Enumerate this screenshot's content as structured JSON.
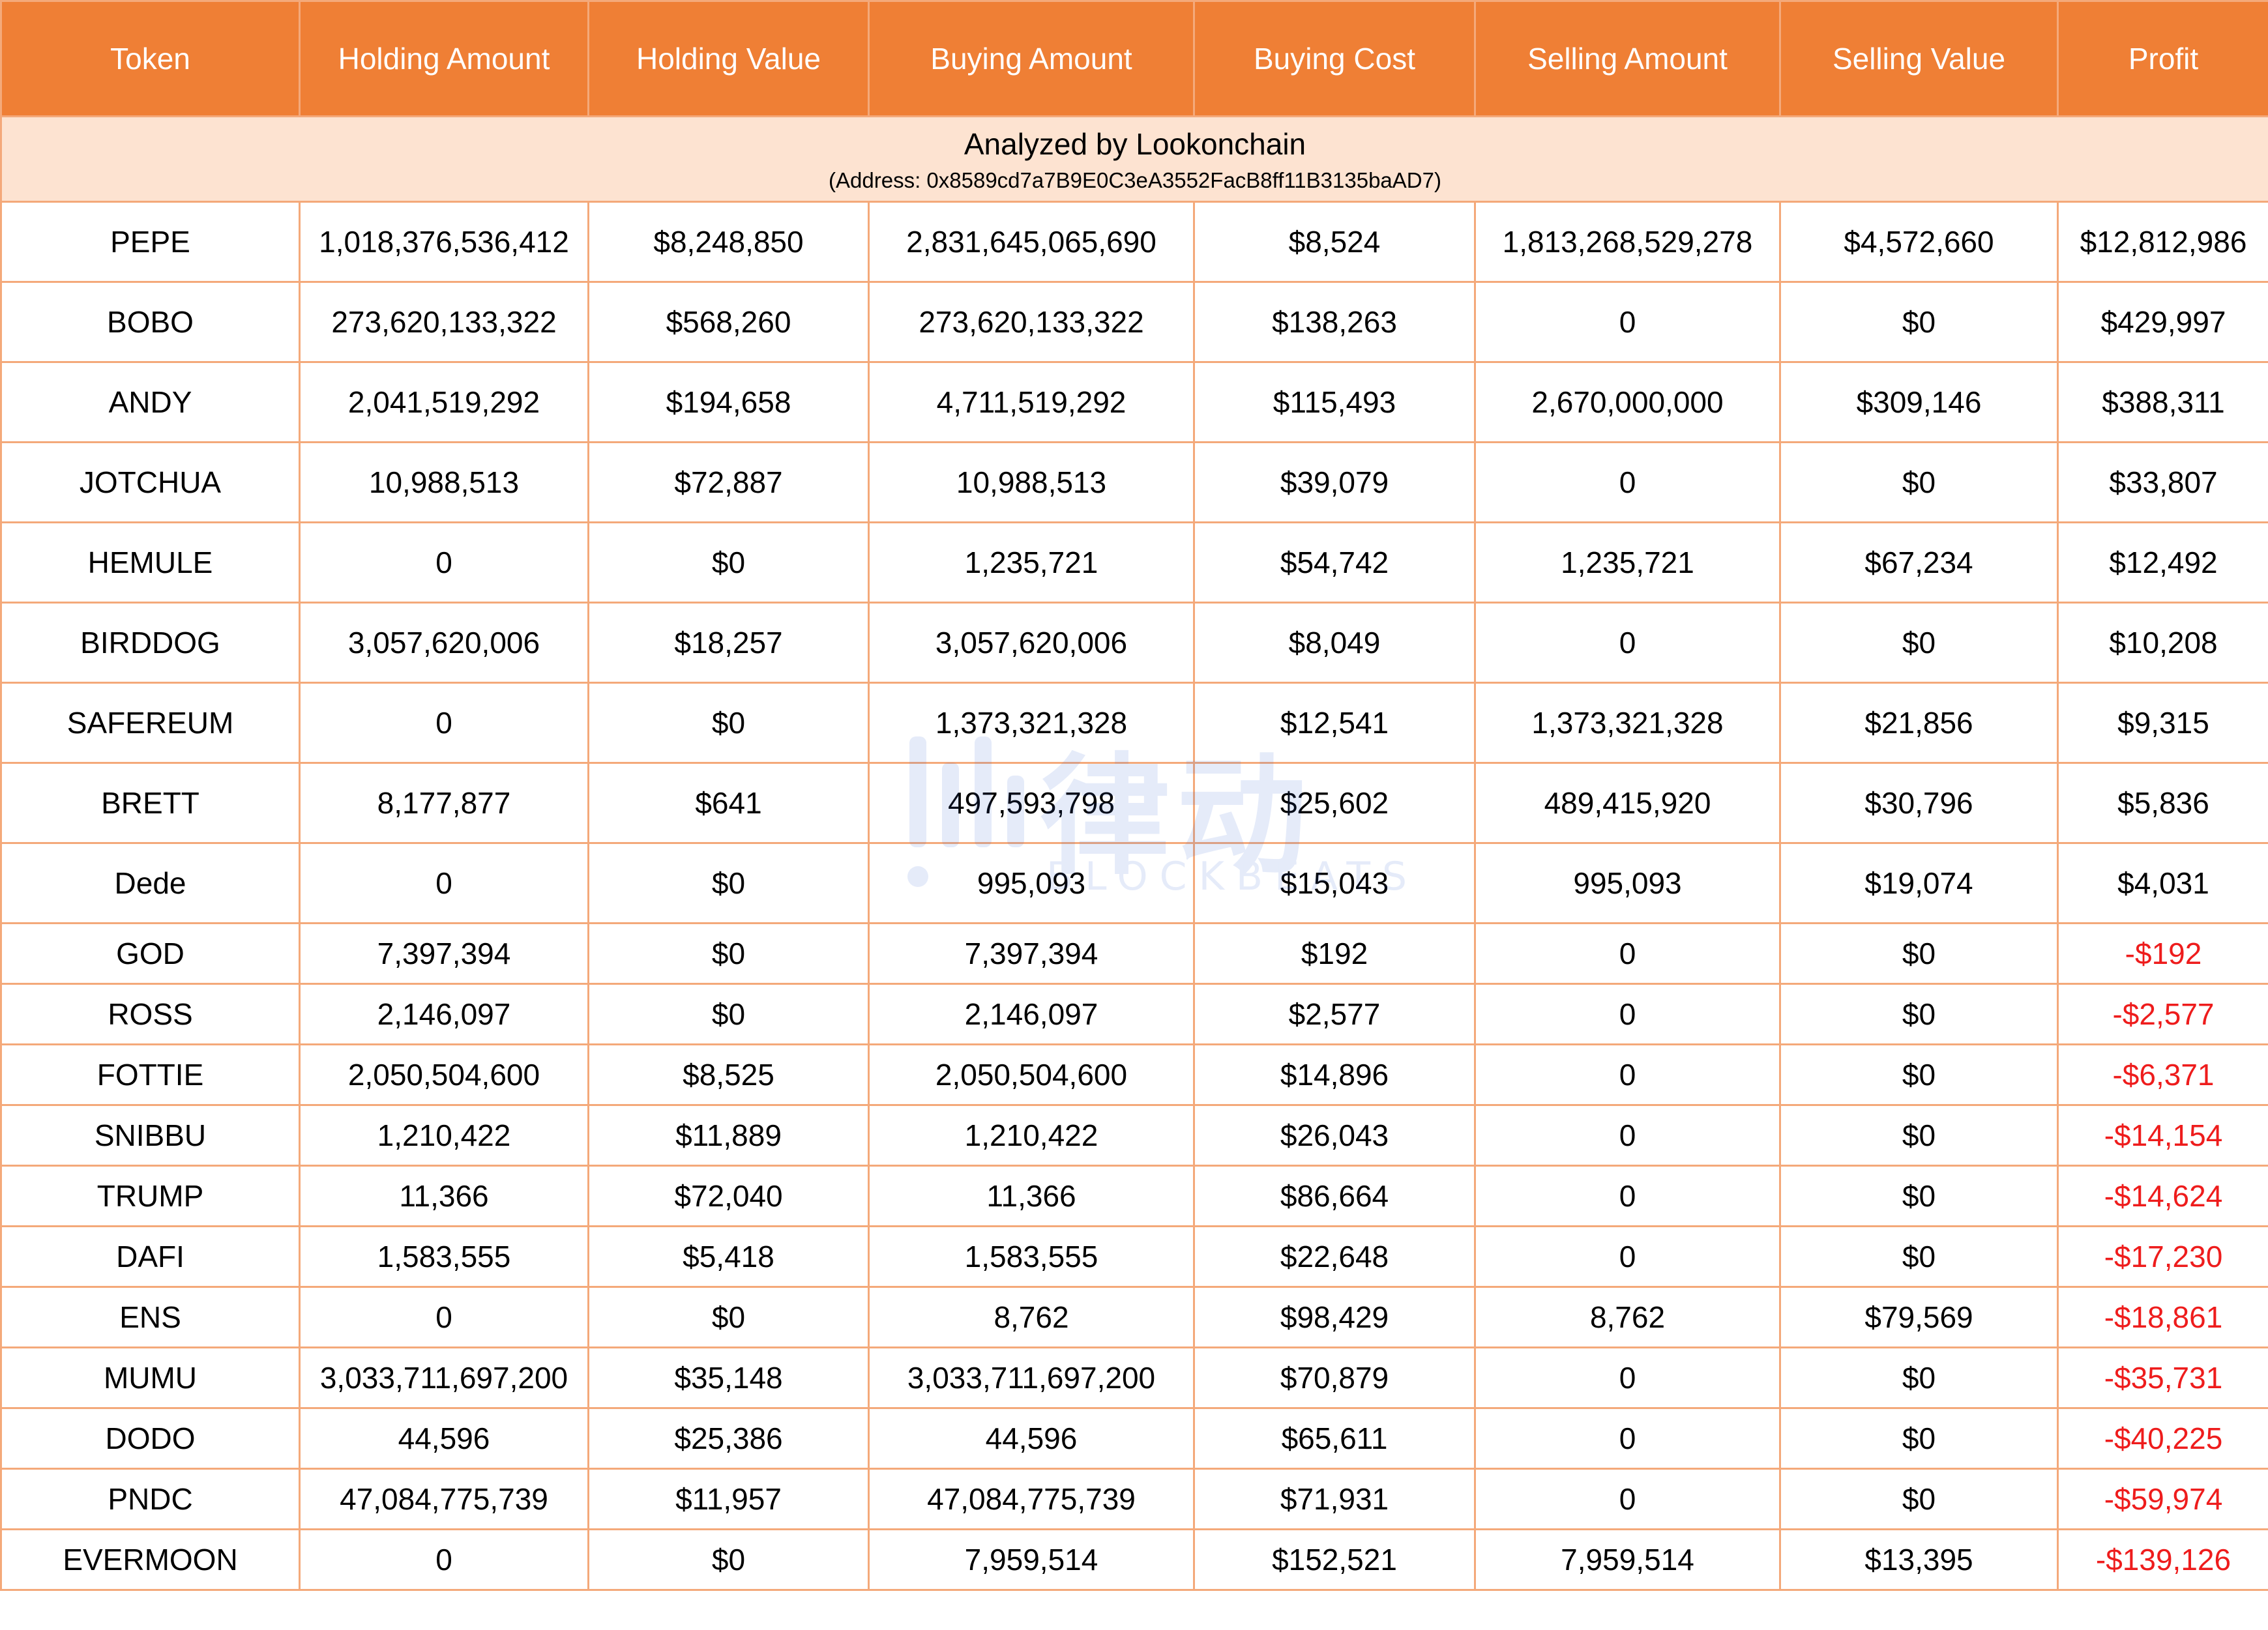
{
  "columns": [
    "Token",
    "Holding Amount",
    "Holding Value",
    "Buying Amount",
    "Buying Cost",
    "Selling Amount",
    "Selling Value",
    "Profit"
  ],
  "banner": {
    "title": "Analyzed by Lookonchain",
    "address": "(Address: 0x8589cd7a7B9E0C3eA3552FacB8ff11B3135baAD7)"
  },
  "watermark": {
    "cn": "律动",
    "en": "BLOCKBEATS",
    "color": "#2f62d6"
  },
  "colors": {
    "header_bg": "#ef7f35",
    "banner_bg": "#fde3d1",
    "border": "#f4a97a",
    "negative": "#ee1c1c"
  },
  "rows": [
    {
      "token": "PEPE",
      "holding_amount": "1,018,376,536,412",
      "holding_value": "$8,248,850",
      "buying_amount": "2,831,645,065,690",
      "buying_cost": "$8,524",
      "selling_amount": "1,813,268,529,278",
      "selling_value": "$4,572,660",
      "profit": "$12,812,986"
    },
    {
      "token": "BOBO",
      "holding_amount": "273,620,133,322",
      "holding_value": "$568,260",
      "buying_amount": "273,620,133,322",
      "buying_cost": "$138,263",
      "selling_amount": "0",
      "selling_value": "$0",
      "profit": "$429,997"
    },
    {
      "token": "ANDY",
      "holding_amount": "2,041,519,292",
      "holding_value": "$194,658",
      "buying_amount": "4,711,519,292",
      "buying_cost": "$115,493",
      "selling_amount": "2,670,000,000",
      "selling_value": "$309,146",
      "profit": "$388,311"
    },
    {
      "token": "JOTCHUA",
      "holding_amount": "10,988,513",
      "holding_value": "$72,887",
      "buying_amount": "10,988,513",
      "buying_cost": "$39,079",
      "selling_amount": "0",
      "selling_value": "$0",
      "profit": "$33,807"
    },
    {
      "token": "HEMULE",
      "holding_amount": "0",
      "holding_value": "$0",
      "buying_amount": "1,235,721",
      "buying_cost": "$54,742",
      "selling_amount": "1,235,721",
      "selling_value": "$67,234",
      "profit": "$12,492"
    },
    {
      "token": "BIRDDOG",
      "holding_amount": "3,057,620,006",
      "holding_value": "$18,257",
      "buying_amount": "3,057,620,006",
      "buying_cost": "$8,049",
      "selling_amount": "0",
      "selling_value": "$0",
      "profit": "$10,208"
    },
    {
      "token": "SAFEREUM",
      "holding_amount": "0",
      "holding_value": "$0",
      "buying_amount": "1,373,321,328",
      "buying_cost": "$12,541",
      "selling_amount": "1,373,321,328",
      "selling_value": "$21,856",
      "profit": "$9,315"
    },
    {
      "token": "BRETT",
      "holding_amount": "8,177,877",
      "holding_value": "$641",
      "buying_amount": "497,593,798",
      "buying_cost": "$25,602",
      "selling_amount": "489,415,920",
      "selling_value": "$30,796",
      "profit": "$5,836"
    },
    {
      "token": "Dede",
      "holding_amount": "0",
      "holding_value": "$0",
      "buying_amount": "995,093",
      "buying_cost": "$15,043",
      "selling_amount": "995,093",
      "selling_value": "$19,074",
      "profit": "$4,031"
    },
    {
      "token": "GOD",
      "holding_amount": "7,397,394",
      "holding_value": "$0",
      "buying_amount": "7,397,394",
      "buying_cost": "$192",
      "selling_amount": "0",
      "selling_value": "$0",
      "profit": "-$192"
    },
    {
      "token": "ROSS",
      "holding_amount": "2,146,097",
      "holding_value": "$0",
      "buying_amount": "2,146,097",
      "buying_cost": "$2,577",
      "selling_amount": "0",
      "selling_value": "$0",
      "profit": "-$2,577"
    },
    {
      "token": "FOTTIE",
      "holding_amount": "2,050,504,600",
      "holding_value": "$8,525",
      "buying_amount": "2,050,504,600",
      "buying_cost": "$14,896",
      "selling_amount": "0",
      "selling_value": "$0",
      "profit": "-$6,371"
    },
    {
      "token": "SNIBBU",
      "holding_amount": "1,210,422",
      "holding_value": "$11,889",
      "buying_amount": "1,210,422",
      "buying_cost": "$26,043",
      "selling_amount": "0",
      "selling_value": "$0",
      "profit": "-$14,154"
    },
    {
      "token": "TRUMP",
      "holding_amount": "11,366",
      "holding_value": "$72,040",
      "buying_amount": "11,366",
      "buying_cost": "$86,664",
      "selling_amount": "0",
      "selling_value": "$0",
      "profit": "-$14,624"
    },
    {
      "token": "DAFI",
      "holding_amount": "1,583,555",
      "holding_value": "$5,418",
      "buying_amount": "1,583,555",
      "buying_cost": "$22,648",
      "selling_amount": "0",
      "selling_value": "$0",
      "profit": "-$17,230"
    },
    {
      "token": "ENS",
      "holding_amount": "0",
      "holding_value": "$0",
      "buying_amount": "8,762",
      "buying_cost": "$98,429",
      "selling_amount": "8,762",
      "selling_value": "$79,569",
      "profit": "-$18,861"
    },
    {
      "token": "MUMU",
      "holding_amount": "3,033,711,697,200",
      "holding_value": "$35,148",
      "buying_amount": "3,033,711,697,200",
      "buying_cost": "$70,879",
      "selling_amount": "0",
      "selling_value": "$0",
      "profit": "-$35,731"
    },
    {
      "token": "DODO",
      "holding_amount": "44,596",
      "holding_value": "$25,386",
      "buying_amount": "44,596",
      "buying_cost": "$65,611",
      "selling_amount": "0",
      "selling_value": "$0",
      "profit": "-$40,225"
    },
    {
      "token": "PNDC",
      "holding_amount": "47,084,775,739",
      "holding_value": "$11,957",
      "buying_amount": "47,084,775,739",
      "buying_cost": "$71,931",
      "selling_amount": "0",
      "selling_value": "$0",
      "profit": "-$59,974"
    },
    {
      "token": "EVERMOON",
      "holding_amount": "0",
      "holding_value": "$0",
      "buying_amount": "7,959,514",
      "buying_cost": "$152,521",
      "selling_amount": "7,959,514",
      "selling_value": "$13,395",
      "profit": "-$139,126"
    }
  ]
}
